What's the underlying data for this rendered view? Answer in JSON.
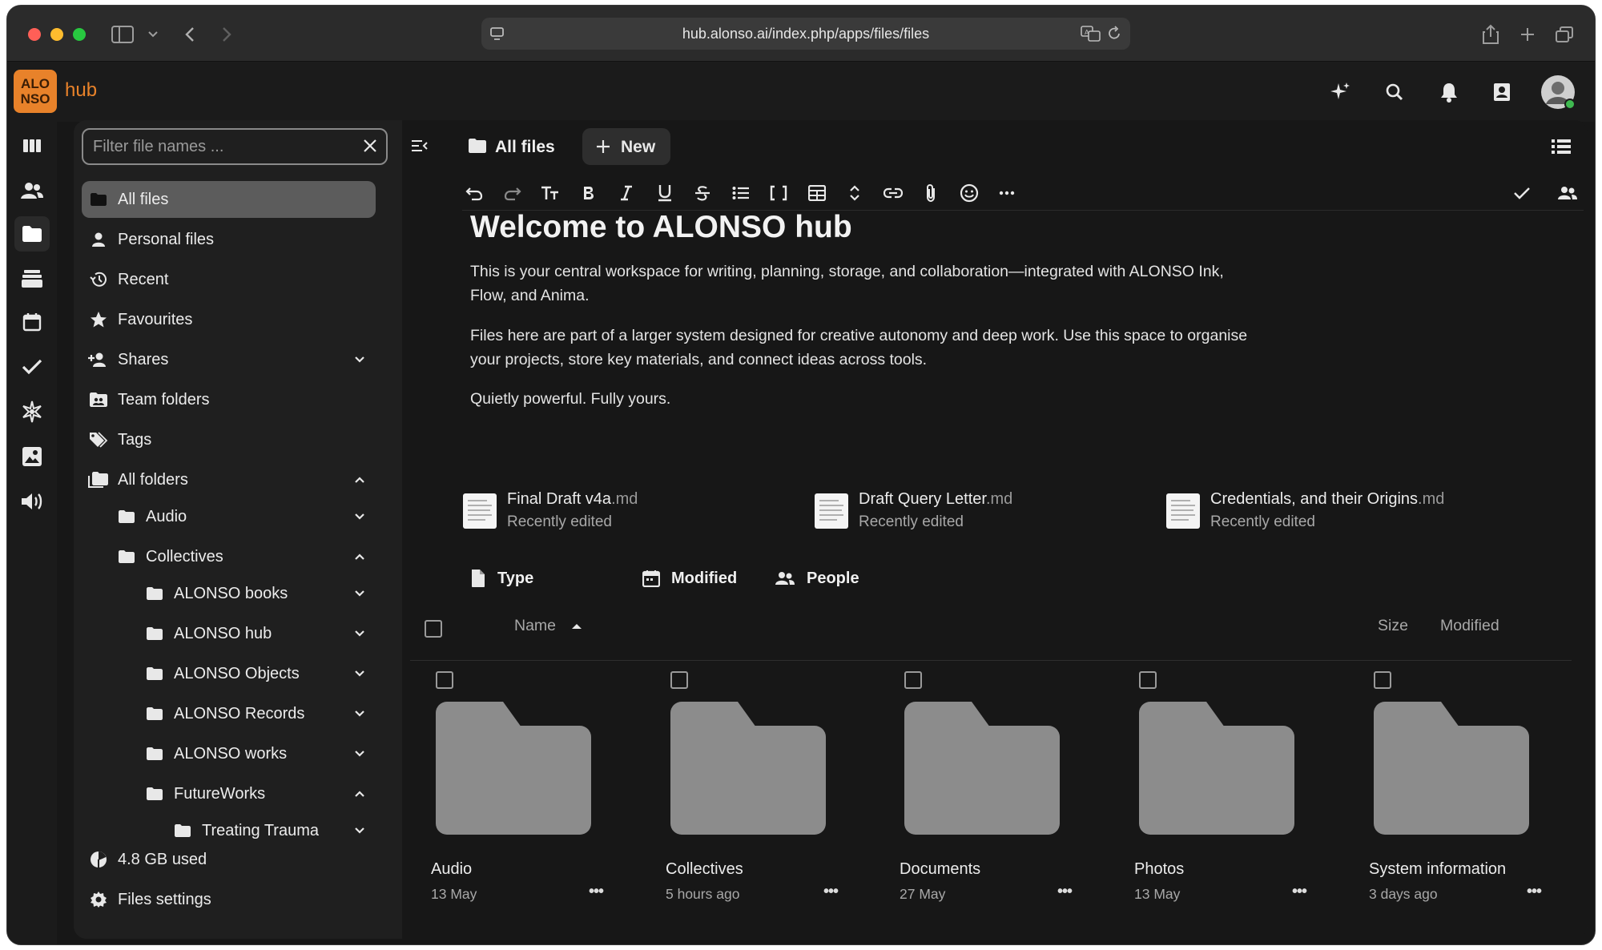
{
  "browser": {
    "url": "hub.alonso.ai/index.php/apps/files/files"
  },
  "app": {
    "logo_line1": "ALO",
    "logo_line2": "NSO",
    "brand": "hub"
  },
  "sidebar": {
    "filter_placeholder": "Filter file names ...",
    "items": [
      {
        "label": "All files",
        "icon": "folder-icon"
      },
      {
        "label": "Personal files",
        "icon": "person-icon"
      },
      {
        "label": "Recent",
        "icon": "history-icon"
      },
      {
        "label": "Favourites",
        "icon": "star-icon"
      },
      {
        "label": "Shares",
        "icon": "share-person-icon"
      },
      {
        "label": "Team folders",
        "icon": "team-folder-icon"
      },
      {
        "label": "Tags",
        "icon": "tag-icon"
      },
      {
        "label": "All folders",
        "icon": "folders-icon"
      }
    ],
    "tree": [
      {
        "label": "Audio"
      },
      {
        "label": "Collectives"
      },
      {
        "label": "ALONSO books"
      },
      {
        "label": "ALONSO hub"
      },
      {
        "label": "ALONSO Objects"
      },
      {
        "label": "ALONSO Records"
      },
      {
        "label": "ALONSO works"
      },
      {
        "label": "FutureWorks"
      },
      {
        "label": "Treating Trauma"
      }
    ],
    "storage": "4.8 GB used",
    "settings": "Files settings"
  },
  "breadcrumb": {
    "all_files": "All files",
    "new_label": "New"
  },
  "document": {
    "title": "Welcome to ALONSO hub",
    "p1": "This is your central workspace for writing, planning, storage, and collaboration—integrated with ALONSO Ink, Flow, and Anima.",
    "p2": "Files here are part of a larger system designed for creative autonomy and deep work. Use this space to organise your projects, store key materials, and connect ideas across tools.",
    "p3": "Quietly powerful. Fully yours."
  },
  "recent_files": [
    {
      "name": "Final Draft v4a",
      "ext": ".md",
      "sub": "Recently edited"
    },
    {
      "name": "Draft Query Letter",
      "ext": ".md",
      "sub": "Recently edited"
    },
    {
      "name": "Credentials, and their Origins",
      "ext": ".md",
      "sub": "Recently edited"
    }
  ],
  "filters": {
    "type": "Type",
    "modified": "Modified",
    "people": "People"
  },
  "columns": {
    "name": "Name",
    "size": "Size",
    "modified": "Modified"
  },
  "folders": [
    {
      "name": "Audio",
      "date": "13 May"
    },
    {
      "name": "Collectives",
      "date": "5 hours ago"
    },
    {
      "name": "Documents",
      "date": "27 May"
    },
    {
      "name": "Photos",
      "date": "13 May"
    },
    {
      "name": "System information",
      "date": "3 days ago"
    }
  ],
  "colors": {
    "accent": "#e8822a",
    "background": "#171717",
    "sidebar": "#1f1f1f",
    "active_item": "#5c5c5c",
    "folder": "#8c8c8c",
    "online": "#3fb950"
  }
}
